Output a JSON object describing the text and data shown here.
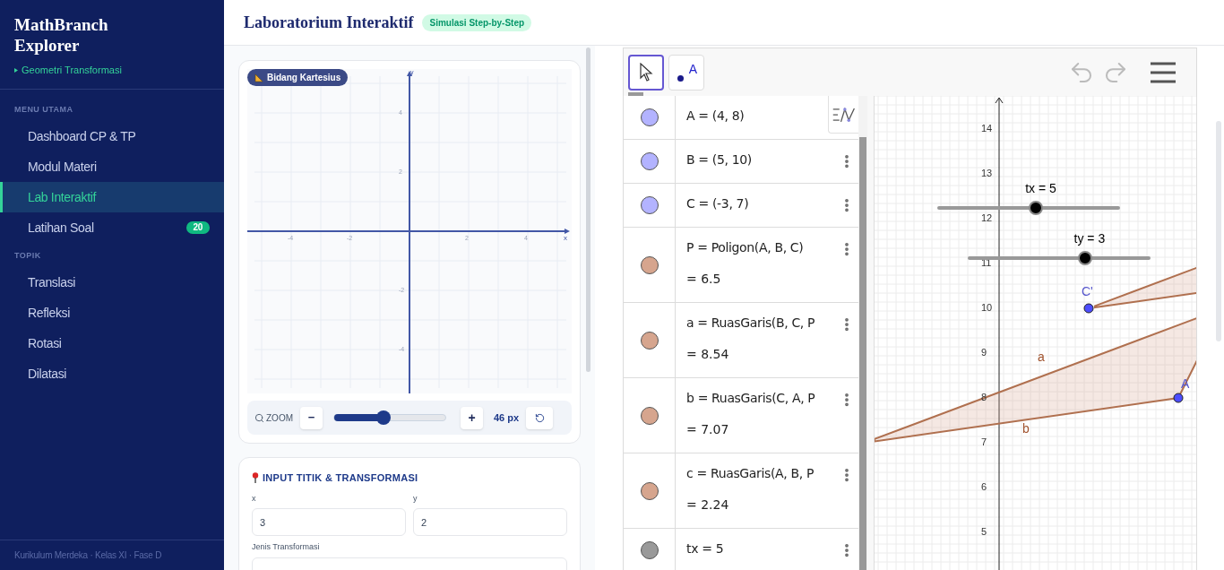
{
  "sidebar": {
    "brand": "MathBranch Explorer",
    "subtitle": "Geometri Transformasi",
    "sections": [
      {
        "heading": "MENU UTAMA",
        "items": [
          {
            "label": "Dashboard CP & TP",
            "selected": false
          },
          {
            "label": "Modul Materi",
            "selected": false
          },
          {
            "label": "Lab Interaktif",
            "selected": true
          },
          {
            "label": "Latihan Soal",
            "selected": false,
            "badge": "20"
          }
        ]
      },
      {
        "heading": "TOPIK",
        "items": [
          {
            "label": "Translasi",
            "selected": false
          },
          {
            "label": "Refleksi",
            "selected": false
          },
          {
            "label": "Rotasi",
            "selected": false
          },
          {
            "label": "Dilatasi",
            "selected": false
          }
        ]
      }
    ],
    "footer": "Kurikulum Merdeka · Kelas XI · Fase D"
  },
  "header": {
    "title": "Laboratorium Interaktif",
    "badge": "Simulasi Step-by-Step"
  },
  "plane_card": {
    "label": "Bidang Kartesius",
    "x_ticks": [
      "-4",
      "-2",
      "2",
      "4"
    ],
    "y_ticks": [
      "4",
      "2",
      "-2",
      "-4"
    ],
    "x_axis_label": "x",
    "y_axis_label": "y",
    "zoom": {
      "label": "ZOOM",
      "minus": "−",
      "plus": "+",
      "level": 0.44,
      "value": "46",
      "unit": "px"
    }
  },
  "input_card": {
    "title": "INPUT TITIK & TRANSFORMASI",
    "fields": [
      {
        "label": "x",
        "value": "3"
      },
      {
        "label": "y",
        "value": "2"
      }
    ],
    "select_label": "Jenis Transformasi"
  },
  "applet": {
    "tools": [
      {
        "kind": "move",
        "selected": true
      },
      {
        "kind": "point",
        "label": "A",
        "selected": false
      }
    ],
    "algebra": [
      {
        "definition": "A = (4, 8)",
        "color": "#b3b3ff",
        "menu": false
      },
      {
        "definition": "B = (5, 10)",
        "color": "#b3b3ff",
        "menu": true
      },
      {
        "definition": "C = (-3, 7)",
        "color": "#b3b3ff",
        "menu": true
      },
      {
        "definition": "P = Poligon(A, B, C)",
        "value": "= 6.5",
        "color": "#d6a58e",
        "menu": true
      },
      {
        "definition": "a = RuasGaris(B, C, P",
        "value": "= 8.54",
        "color": "#d6a58e",
        "menu": true
      },
      {
        "definition": "b = RuasGaris(C, A, P",
        "value": "= 7.07",
        "color": "#d6a58e",
        "menu": true
      },
      {
        "definition": "c = RuasGaris(A, B, P",
        "value": "= 2.24",
        "color": "#d6a58e",
        "menu": true
      },
      {
        "definition": "tx = 5",
        "color": "#999999",
        "menu": true
      }
    ],
    "graphics": {
      "y_ticks": [
        "14",
        "13",
        "12",
        "11",
        "10",
        "9",
        "8",
        "7",
        "6",
        "5"
      ],
      "sliders": [
        {
          "label": "tx = 5",
          "level": 0.54
        },
        {
          "label": "ty = 3",
          "level": 0.64
        }
      ],
      "labels": [
        {
          "text": "C'",
          "kind": "point"
        },
        {
          "text": "A",
          "kind": "point"
        },
        {
          "text": "a",
          "kind": "segment"
        },
        {
          "text": "b",
          "kind": "segment"
        }
      ]
    }
  }
}
